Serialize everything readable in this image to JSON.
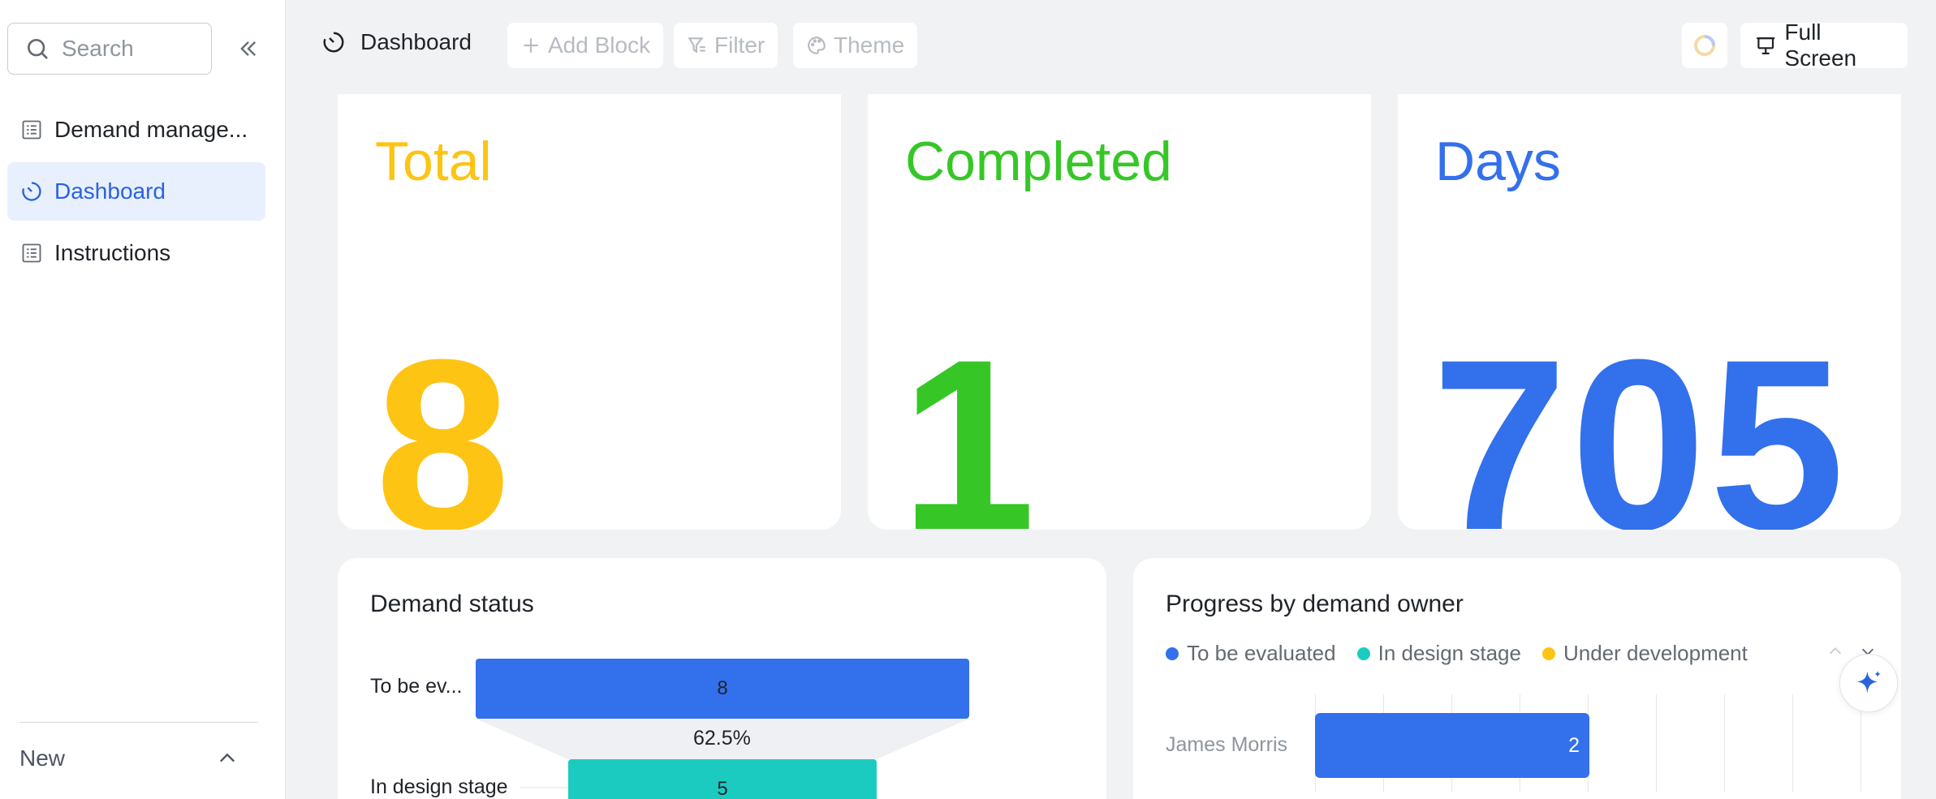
{
  "sidebar": {
    "search_placeholder": "Search",
    "items": [
      {
        "label": "Demand manage...",
        "icon": "table-icon",
        "active": false
      },
      {
        "label": "Dashboard",
        "icon": "dashboard-icon",
        "active": true
      },
      {
        "label": "Instructions",
        "icon": "table-icon",
        "active": false
      }
    ],
    "new_label": "New"
  },
  "toolbar": {
    "title": "Dashboard",
    "add_block": "Add Block",
    "filter": "Filter",
    "theme": "Theme",
    "full_screen": "Full Screen"
  },
  "stats": [
    {
      "title": "Total",
      "value": "8",
      "color": "#fdc414"
    },
    {
      "title": "Completed",
      "value": "1",
      "color": "#36c726"
    },
    {
      "title": "Days",
      "value": "705",
      "color": "#3370eb"
    }
  ],
  "demand_status": {
    "title": "Demand status",
    "stages": [
      {
        "label": "To be ev...",
        "value": "8",
        "color": "#3370eb"
      },
      {
        "label": "In design stage",
        "value": "5",
        "color": "#1ccbc0"
      }
    ],
    "conversion": "62.5%"
  },
  "progress_by_owner": {
    "title": "Progress by demand owner",
    "legend": [
      {
        "label": "To be evaluated",
        "color": "#3370eb"
      },
      {
        "label": "In design stage",
        "color": "#1ccbc0"
      },
      {
        "label": "Under development",
        "color": "#fdc414"
      }
    ],
    "rows": [
      {
        "owner": "James Morris",
        "value": "2",
        "color": "#3370eb"
      }
    ]
  }
}
